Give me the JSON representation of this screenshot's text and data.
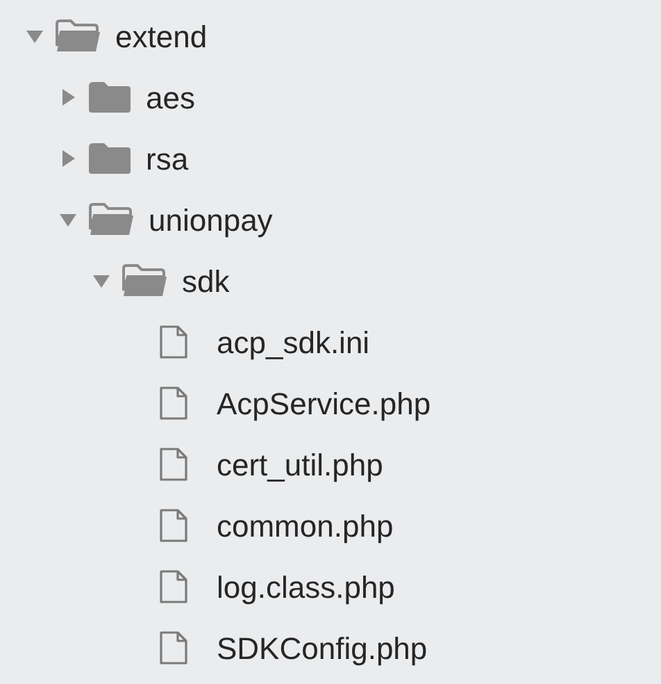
{
  "tree": [
    {
      "kind": "folder",
      "name": "extend",
      "expanded": true,
      "children": [
        {
          "kind": "folder",
          "name": "aes",
          "expanded": false
        },
        {
          "kind": "folder",
          "name": "rsa",
          "expanded": false
        },
        {
          "kind": "folder",
          "name": "unionpay",
          "expanded": true,
          "children": [
            {
              "kind": "folder",
              "name": "sdk",
              "expanded": true,
              "children": [
                {
                  "kind": "file",
                  "name": "acp_sdk.ini"
                },
                {
                  "kind": "file",
                  "name": "AcpService.php"
                },
                {
                  "kind": "file",
                  "name": "cert_util.php"
                },
                {
                  "kind": "file",
                  "name": "common.php"
                },
                {
                  "kind": "file",
                  "name": "log.class.php"
                },
                {
                  "kind": "file",
                  "name": "SDKConfig.php"
                }
              ]
            }
          ]
        }
      ]
    }
  ]
}
